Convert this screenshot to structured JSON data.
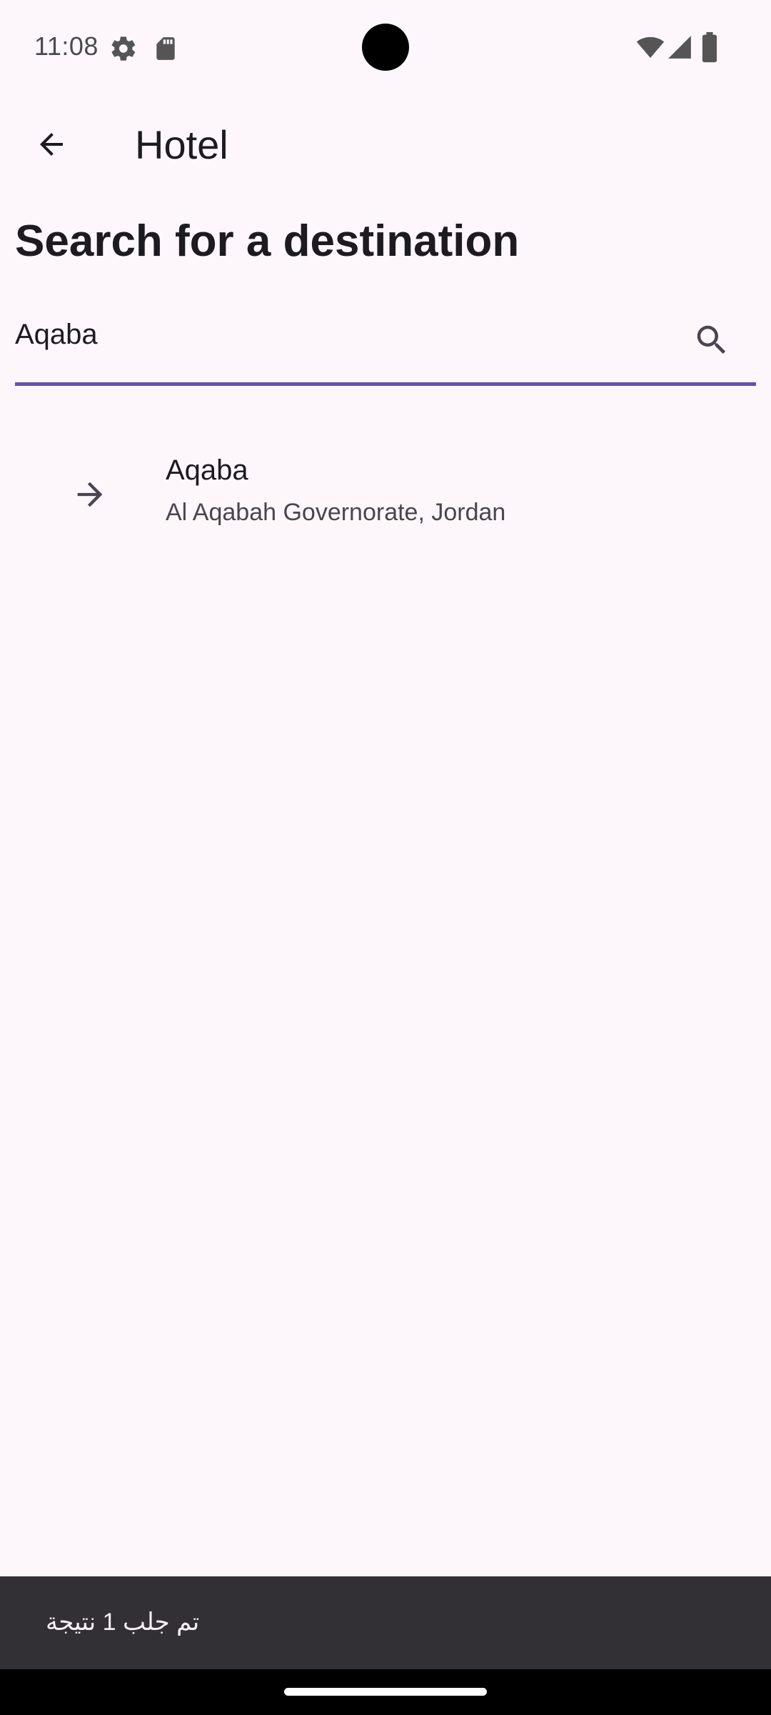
{
  "status_bar": {
    "time": "11:08",
    "left_icons": [
      "settings-icon",
      "sd-card-icon"
    ],
    "right_icons": [
      "wifi-icon",
      "cell-signal-icon",
      "battery-icon"
    ]
  },
  "app_bar": {
    "title": "Hotel",
    "back_icon": "arrow-back-icon"
  },
  "heading": "Search for a destination",
  "search": {
    "value": "Aqaba",
    "icon": "search-icon",
    "accent_color": "#6750a4"
  },
  "results": [
    {
      "title": "Aqaba",
      "subtitle": "Al Aqabah Governorate, Jordan",
      "icon": "arrow-forward-icon"
    }
  ],
  "snackbar": {
    "text": "تم جلب 1 نتيجة"
  },
  "colors": {
    "background": "#fdf7fc",
    "snackbar_bg": "#322f35",
    "accent": "#6750a4"
  }
}
